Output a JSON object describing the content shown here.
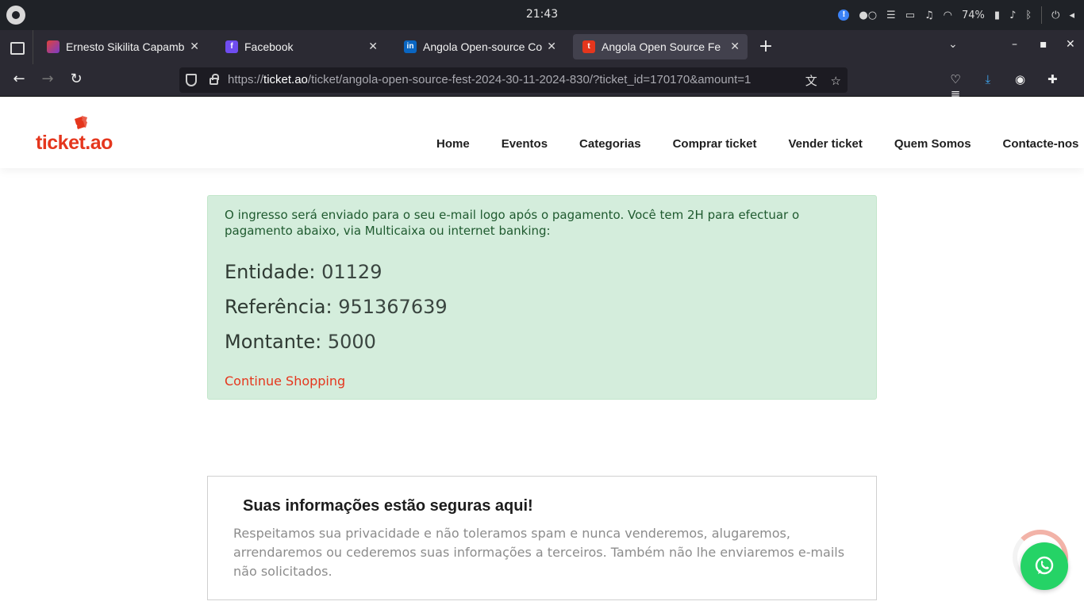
{
  "os": {
    "clock": "21:43",
    "battery": "74%"
  },
  "browser": {
    "tabs": [
      {
        "title": "Ernesto Sikilita Capamb",
        "favicon": "vivaldi-icon",
        "active": false
      },
      {
        "title": "Facebook",
        "favicon": "facebook-icon",
        "active": false
      },
      {
        "title": "Angola Open-source Co",
        "favicon": "linkedin-icon",
        "active": false
      },
      {
        "title": "Angola Open Source Fe",
        "favicon": "ticket-icon",
        "active": true
      }
    ],
    "url": {
      "scheme": "https://",
      "host": "ticket.ao",
      "path": "/ticket/angola-open-source-fest-2024-30-11-2024-830/?ticket_id=170170&amount=1"
    }
  },
  "site": {
    "logo_text": "ticket.ao",
    "menu": [
      "Home",
      "Eventos",
      "Categorias",
      "Comprar ticket",
      "Vender ticket",
      "Quem Somos",
      "Contacte-nos"
    ]
  },
  "payment": {
    "message": "O ingresso será enviado para o seu e-mail logo após o pagamento. Você tem 2H para efectuar o pagamento abaixo, via Multicaixa ou internet banking:",
    "entidade_label": "Entidade:",
    "entidade_value": "01129",
    "referencia_label": "Referência:",
    "referencia_value": "951367639",
    "montante_label": "Montante:",
    "montante_value": "5000",
    "continue_label": "Continue Shopping"
  },
  "secure": {
    "title": "Suas informações estão seguras aqui!",
    "text": "Respeitamos sua privacidade e não toleramos spam e nunca venderemos, alugaremos, arrendaremos ou cederemos suas informações a terceiros. Também não lhe enviaremos e-mails não solicitados."
  },
  "colors": {
    "brand": "#e5361d",
    "alert_bg": "#d4eddc",
    "whatsapp": "#25d366"
  }
}
